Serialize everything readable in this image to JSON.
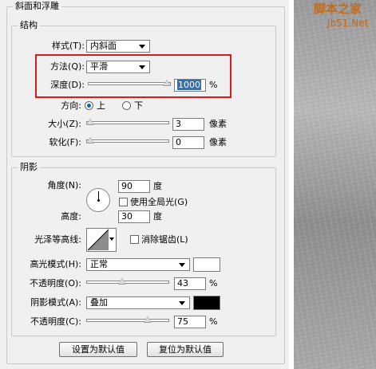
{
  "panel": {
    "section_title": "斜面和浮雕",
    "structure": {
      "title": "结构",
      "style_label": "样式(T):",
      "style_value": "内斜面",
      "technique_label": "方法(Q):",
      "technique_value": "平滑",
      "depth_label": "深度(D):",
      "depth_value": "1000",
      "depth_level_percent": 100,
      "percent_unit": "%",
      "direction_label": "方向:",
      "direction_up": "上",
      "direction_down": "下",
      "size_label": "大小(Z):",
      "size_value": "3",
      "size_unit": "像素",
      "soften_label": "软化(F):",
      "soften_value": "0",
      "soften_unit": "像素"
    },
    "shading": {
      "title": "阴影",
      "angle_label": "角度(N):",
      "angle_value": "90",
      "degree_unit": "度",
      "global_light_label": "使用全局光(G)",
      "altitude_label": "高度:",
      "altitude_value": "30",
      "gloss_contour_label": "光泽等高线:",
      "anti_aliased_label": "消除锯齿(L)",
      "highlight_mode_label": "高光模式(H):",
      "highlight_mode_value": "正常",
      "highlight_color": "#ffffff",
      "highlight_opacity_label": "不透明度(O):",
      "highlight_opacity_value": "43",
      "shadow_mode_label": "阴影模式(A):",
      "shadow_mode_value": "叠加",
      "shadow_color": "#000000",
      "shadow_opacity_label": "不透明度(C):",
      "shadow_opacity_value": "75",
      "percent_unit": "%"
    },
    "buttons": {
      "make_default": "设置为默认值",
      "reset_default": "复位为默认值"
    }
  },
  "watermark": {
    "site_name": "脚本之家",
    "site_url": "Jb51.Net"
  },
  "colors": {
    "highlight_frame": "#d21e1e",
    "selection": "#3a6ea5"
  }
}
